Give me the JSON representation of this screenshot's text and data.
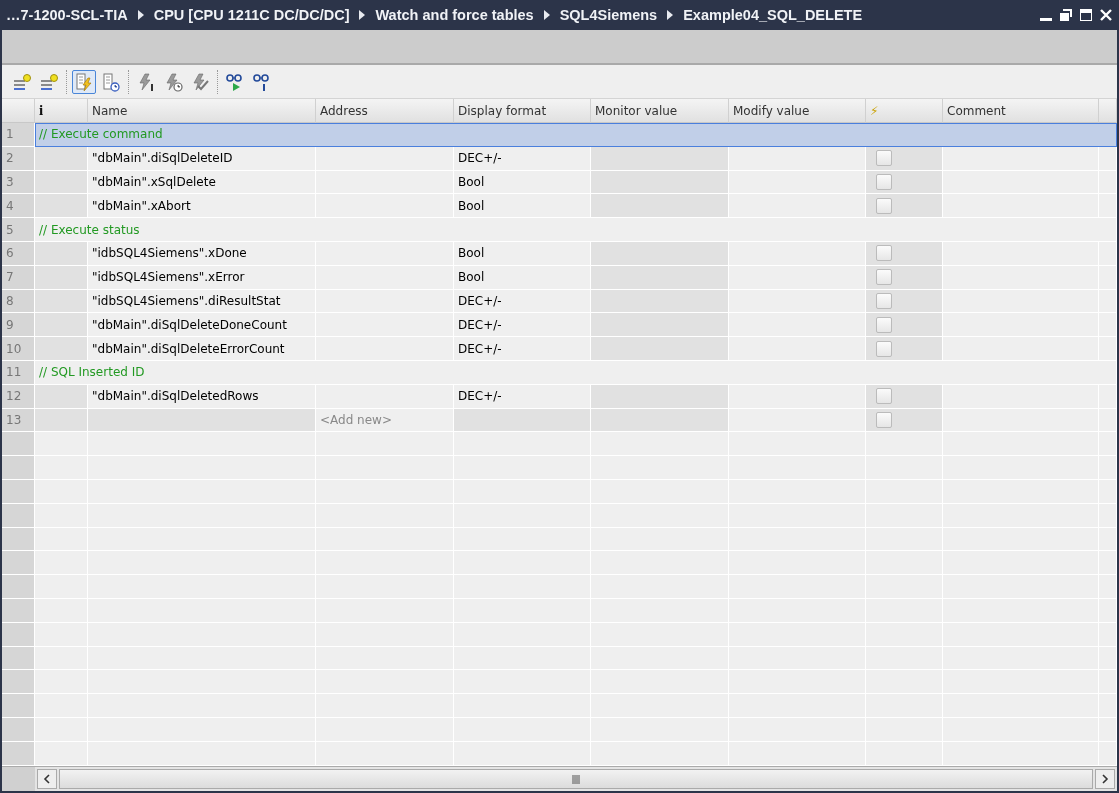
{
  "window": {
    "breadcrumb": [
      "…7-1200-SCL-TIA",
      "CPU [CPU 1211C DC/DC/DC]",
      "Watch and force tables",
      "SQL4Siemens",
      "Example04_SQL_DELETE"
    ]
  },
  "toolbar": [
    {
      "kind": "add-row",
      "selected": false
    },
    {
      "kind": "add-row",
      "selected": false
    },
    {
      "kind": "sep"
    },
    {
      "kind": "monitor-force",
      "selected": true
    },
    {
      "kind": "monitor-trigger",
      "selected": false
    },
    {
      "kind": "sep"
    },
    {
      "kind": "force-once",
      "selected": false
    },
    {
      "kind": "force-trigger",
      "selected": false
    },
    {
      "kind": "force-all",
      "selected": false
    },
    {
      "kind": "sep"
    },
    {
      "kind": "watch-all",
      "selected": false
    },
    {
      "kind": "watch-once",
      "selected": false
    }
  ],
  "table": {
    "columns": [
      "i",
      "Name",
      "Address",
      "Display format",
      "Monitor value",
      "Modify value",
      "⚡",
      "Comment"
    ],
    "rows": [
      {
        "kind": "comment",
        "number": "1",
        "text": "// Execute command",
        "selected": true
      },
      {
        "kind": "entry",
        "number": "2",
        "name": "\"dbMain\".diSqlDeleteID",
        "format": "DEC+/-",
        "force": false,
        "selected": false
      },
      {
        "kind": "entry",
        "number": "3",
        "name": "\"dbMain\".xSqlDelete",
        "format": "Bool",
        "force": false,
        "selected": false
      },
      {
        "kind": "entry",
        "number": "4",
        "name": "\"dbMain\".xAbort",
        "format": "Bool",
        "force": false,
        "selected": false
      },
      {
        "kind": "comment",
        "number": "5",
        "text": "// Execute status",
        "selected": false
      },
      {
        "kind": "entry",
        "number": "6",
        "name": "\"idbSQL4Siemens\".xDone",
        "format": "Bool",
        "force": false,
        "selected": false
      },
      {
        "kind": "entry",
        "number": "7",
        "name": "\"idbSQL4Siemens\".xError",
        "format": "Bool",
        "force": false,
        "selected": false
      },
      {
        "kind": "entry",
        "number": "8",
        "name": "\"idbSQL4Siemens\".diResultStat",
        "format": "DEC+/-",
        "force": false,
        "selected": false
      },
      {
        "kind": "entry",
        "number": "9",
        "name": "\"dbMain\".diSqlDeleteDoneCount",
        "format": "DEC+/-",
        "force": false,
        "selected": false
      },
      {
        "kind": "entry",
        "number": "10",
        "name": "\"dbMain\".diSqlDeleteErrorCount",
        "format": "DEC+/-",
        "force": false,
        "selected": false
      },
      {
        "kind": "comment",
        "number": "11",
        "text": "// SQL Inserted ID",
        "selected": false
      },
      {
        "kind": "entry",
        "number": "12",
        "name": "\"dbMain\".diSqlDeletedRows",
        "format": "DEC+/-",
        "force": false,
        "selected": false
      },
      {
        "kind": "add",
        "number": "13",
        "address": "<Add new>",
        "force": false,
        "selected": false
      }
    ]
  }
}
